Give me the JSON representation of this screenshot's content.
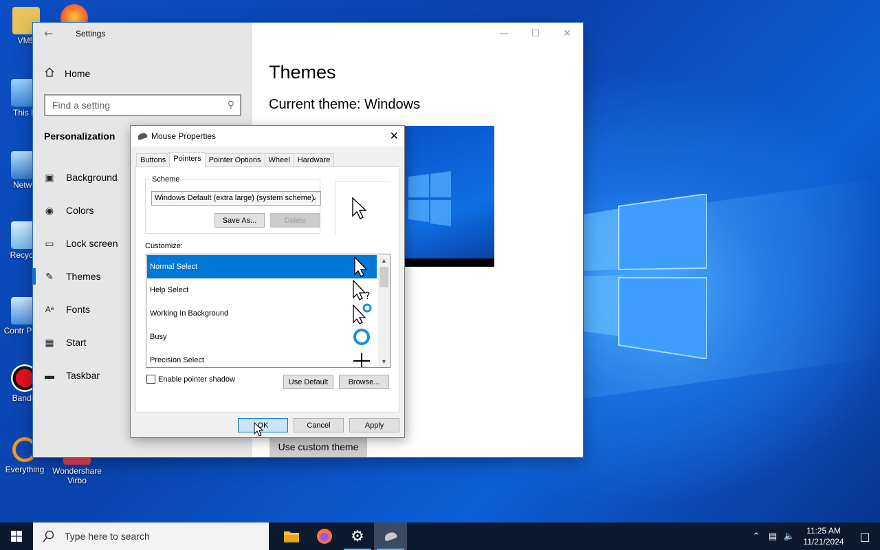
{
  "desktop": {
    "icons": [
      {
        "label": "VM5"
      },
      {
        "label": "This P"
      },
      {
        "label": "Netwo"
      },
      {
        "label": "Recycle"
      },
      {
        "label": "Contr Pane"
      },
      {
        "label": "Bandic"
      },
      {
        "label": "Everything"
      },
      {
        "label": "Wondershare Virbo"
      }
    ]
  },
  "settings": {
    "title": "Settings",
    "home_label": "Home",
    "search_placeholder": "Find a setting",
    "section_title": "Personalization",
    "nav": [
      {
        "label": "Background",
        "icon": "image-icon"
      },
      {
        "label": "Colors",
        "icon": "palette-icon"
      },
      {
        "label": "Lock screen",
        "icon": "lock-screen-icon"
      },
      {
        "label": "Themes",
        "icon": "brush-icon",
        "active": true
      },
      {
        "label": "Fonts",
        "icon": "fonts-icon"
      },
      {
        "label": "Start",
        "icon": "start-icon"
      },
      {
        "label": "Taskbar",
        "icon": "taskbar-icon"
      }
    ],
    "main": {
      "heading": "Themes",
      "current_theme": "Current theme: Windows",
      "custom_theme_button": "Use custom theme"
    }
  },
  "mouse_dialog": {
    "title": "Mouse Properties",
    "tabs": [
      "Buttons",
      "Pointers",
      "Pointer Options",
      "Wheel",
      "Hardware"
    ],
    "active_tab": "Pointers",
    "scheme": {
      "label": "Scheme",
      "selected": "Windows Default (extra large) (system scheme)",
      "save_as": "Save As...",
      "delete": "Delete"
    },
    "customize_label": "Customize:",
    "cursors": [
      {
        "label": "Normal Select",
        "icon": "arrow-cursor-icon",
        "selected": true
      },
      {
        "label": "Help Select",
        "icon": "help-cursor-icon"
      },
      {
        "label": "Working In Background",
        "icon": "working-cursor-icon"
      },
      {
        "label": "Busy",
        "icon": "busy-cursor-icon"
      },
      {
        "label": "Precision Select",
        "icon": "crosshair-cursor-icon"
      }
    ],
    "shadow_label": "Enable pointer shadow",
    "use_default": "Use Default",
    "browse": "Browse...",
    "ok": "OK",
    "cancel": "Cancel",
    "apply": "Apply"
  },
  "taskbar": {
    "search_placeholder": "Type here to search",
    "time": "11:25 AM",
    "date": "11/21/2024"
  },
  "colors": {
    "accent": "#0078d7",
    "taskbar": "#0c1a2f"
  }
}
